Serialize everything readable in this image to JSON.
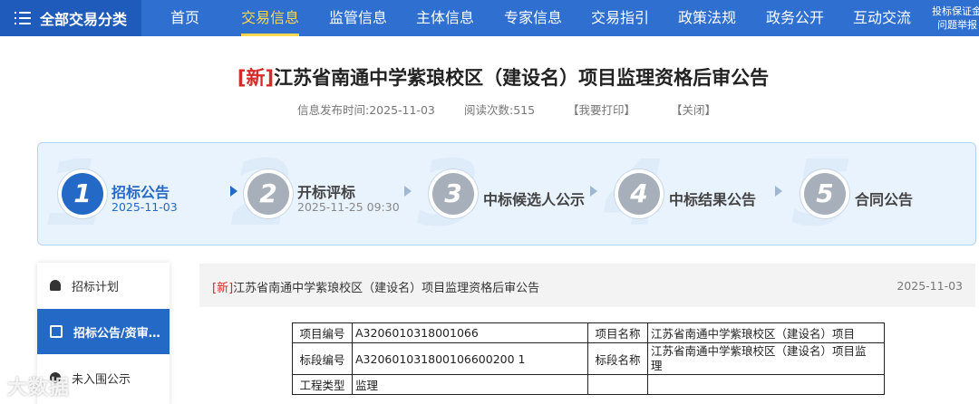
{
  "nav": {
    "all_label": "全部交易分类",
    "items": [
      "首页",
      "交易信息",
      "监管信息",
      "主体信息",
      "专家信息",
      "交易指引",
      "政策法规",
      "政务公开",
      "互动交流"
    ],
    "active": "交易信息",
    "side_line1": "投标保证金",
    "side_line2": "问题举报"
  },
  "article": {
    "tag": "[新]",
    "title": "江苏省南通中学紫琅校区（建设名）项目监理资格后审公告",
    "publish_time": "信息发布时间:2025-11-03",
    "read_count": "阅读次数:515",
    "print": "【我要打印】",
    "close": "【关闭】"
  },
  "steps": [
    {
      "num": "1",
      "label": "招标公告",
      "date": "2025-11-03",
      "active": true
    },
    {
      "num": "2",
      "label": "开标评标",
      "date": "2025-11-25 09:30",
      "active": false
    },
    {
      "num": "3",
      "label": "中标候选人公示",
      "date": "",
      "active": false
    },
    {
      "num": "4",
      "label": "中标结果公告",
      "date": "",
      "active": false
    },
    {
      "num": "5",
      "label": "合同公告",
      "date": "",
      "active": false
    }
  ],
  "sidebar": {
    "items": [
      {
        "label": "招标计划",
        "icon": "bell-icon"
      },
      {
        "label": "招标公告/资审…",
        "icon": "document-icon",
        "active": true
      },
      {
        "label": "未入围公示",
        "icon": "person-icon"
      }
    ]
  },
  "content": {
    "tag": "[新]",
    "title": "江苏省南通中学紫琅校区（建设名）项目监理资格后审公告",
    "date": "2025-11-03"
  },
  "table": {
    "row1": {
      "l1": "项目编号",
      "v1": "A3206010318001066",
      "l2": "项目名称",
      "v2": "江苏省南通中学紫琅校区（建设名）项目"
    },
    "row2": {
      "l1": "标段编号",
      "v1": "A320601031800106600200 1",
      "l2": "标段名称",
      "v2a": "江苏省南通中学紫琅校区（建设名）项目监",
      "v2b": "理"
    },
    "row3": {
      "l1": "工程类型",
      "v1": "监理",
      "l2": "",
      "v2": ""
    }
  },
  "watermark": "大数据"
}
